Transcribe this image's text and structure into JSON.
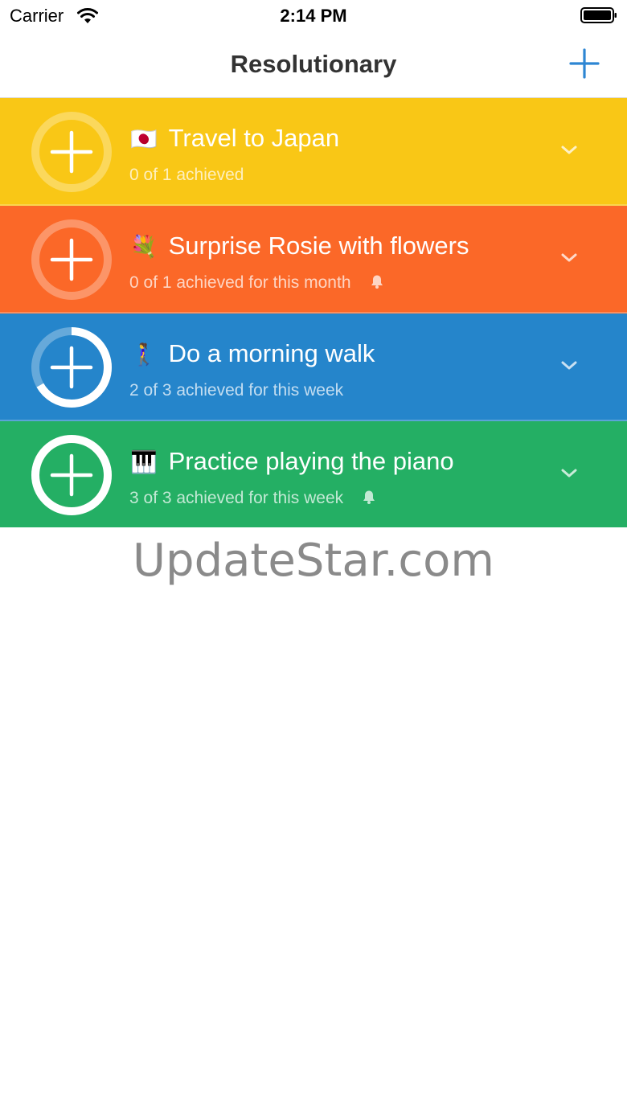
{
  "status_bar": {
    "carrier": "Carrier",
    "time": "2:14 PM"
  },
  "nav": {
    "title": "Resolutionary",
    "add_icon": "plus-icon"
  },
  "resolutions": [
    {
      "emoji": "🇯🇵",
      "title": "Travel to Japan",
      "subtitle": "0 of 1 achieved",
      "color": "#F9C716",
      "progress": 0.0,
      "bell": false
    },
    {
      "emoji": "💐",
      "title": "Surprise Rosie with flowers",
      "subtitle": "0 of 1 achieved for this month",
      "color": "#FB6828",
      "progress": 0.0,
      "bell": true
    },
    {
      "emoji": "🚶‍♀️",
      "title": "Do a morning walk",
      "subtitle": "2 of 3 achieved for this week",
      "color": "#2585CB",
      "progress": 0.6667,
      "bell": false
    },
    {
      "emoji": "🎹",
      "title": "Practice playing the piano",
      "subtitle": "3 of 3 achieved for this week",
      "color": "#24AF64",
      "progress": 1.0,
      "bell": true
    }
  ],
  "watermark": "UpdateStar.com"
}
